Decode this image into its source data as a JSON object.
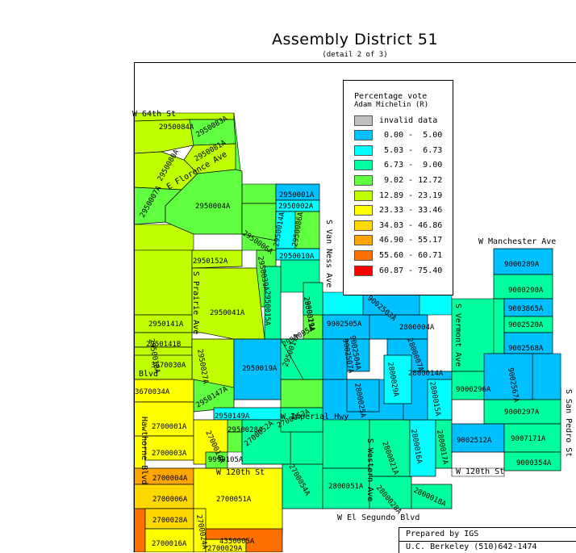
{
  "title": "Assembly District 51",
  "subtitle": "(detail 2 of 3)",
  "legend": {
    "title_line1": "Percentage vote",
    "title_line2": "Adam Michelin (R)",
    "classes": [
      {
        "label": "invalid data",
        "color": "#bfbfbf"
      },
      {
        "label": " 0.00 -  5.00",
        "color": "#00c0ff"
      },
      {
        "label": " 5.03 -  6.73",
        "color": "#00ffff"
      },
      {
        "label": " 6.73 -  9.00",
        "color": "#00ff9f"
      },
      {
        "label": " 9.02 - 12.72",
        "color": "#60ff40"
      },
      {
        "label": "12.89 - 23.19",
        "color": "#c0ff00"
      },
      {
        "label": "23.33 - 33.46",
        "color": "#ffff00"
      },
      {
        "label": "34.03 - 46.86",
        "color": "#ffd800"
      },
      {
        "label": "46.90 - 55.17",
        "color": "#ffa500"
      },
      {
        "label": "55.60 - 60.71",
        "color": "#ff7000"
      },
      {
        "label": "60.87 - 75.40",
        "color": "#ff0000"
      }
    ]
  },
  "streets": {
    "w64": "W 64th St",
    "florence": "E Florence Ave",
    "vanness": "S Van Ness Ave",
    "prairie": "S Prairie Ave",
    "manchester": "W Manchester Ave",
    "vermont": "S Vermont Ave",
    "sanpedro": "S San Pedro St",
    "imperial": "W Imperial Hwy",
    "w120a": "W 120th St",
    "w120b": "W 120th St",
    "western": "S Western Ave",
    "hawthorne": "Hawthorne Blvd",
    "elsegundo": "W El Segundo Blvd",
    "blvd": "Blvd"
  },
  "precincts": [
    {
      "id": "2950084A",
      "c": "#c0ff00"
    },
    {
      "id": "2950083A",
      "c": "#60ff40"
    },
    {
      "id": "2950081A",
      "c": "#c0ff00"
    },
    {
      "id": "2950080A",
      "c": "#c0ff00"
    },
    {
      "id": "2950007A",
      "c": "#60ff40"
    },
    {
      "id": "2950004A",
      "c": "#60ff40"
    },
    {
      "id": "2950001A",
      "c": "#00c0ff"
    },
    {
      "id": "2950002A",
      "c": "#00ffff"
    },
    {
      "id": "2950006A",
      "c": "#60ff40"
    },
    {
      "id": "2950086A",
      "c": "#60ff40"
    },
    {
      "id": "2950014A",
      "c": "#00ffff"
    },
    {
      "id": "2950010A",
      "c": "#00ffff"
    },
    {
      "id": "2950152A",
      "c": "#c0ff00"
    },
    {
      "id": "2950039A",
      "c": "#60ff40"
    },
    {
      "id": "2950041A",
      "c": "#c0ff00"
    },
    {
      "id": "2950015A",
      "c": "#00ff9f"
    },
    {
      "id": "2950141A",
      "c": "#c0ff00"
    },
    {
      "id": "2950141B",
      "c": "#c0ff00"
    },
    {
      "id": "2950018A",
      "c": "#c0ff00"
    },
    {
      "id": "2950027A",
      "c": "#c0ff00"
    },
    {
      "id": "2950019A",
      "c": "#00c0ff"
    },
    {
      "id": "2950017A",
      "c": "#00ff9f"
    },
    {
      "id": "2950029A",
      "c": "#60ff40"
    },
    {
      "id": "2950147A",
      "c": "#60ff40"
    },
    {
      "id": "2950149A",
      "c": "#00ffff"
    },
    {
      "id": "2950028A",
      "c": "#60ff40"
    },
    {
      "id": "3670030A",
      "c": "#c0ff00"
    },
    {
      "id": "3670034A",
      "c": "#ffff00"
    },
    {
      "id": "2700001A",
      "c": "#ffff00"
    },
    {
      "id": "2700003A",
      "c": "#ffff00"
    },
    {
      "id": "2700004A",
      "c": "#ffa500"
    },
    {
      "id": "2700006A",
      "c": "#ffd800"
    },
    {
      "id": "2700014A",
      "c": "#ffff00"
    },
    {
      "id": "9990105A",
      "c": "#60ff40"
    },
    {
      "id": "2700051A",
      "c": "#ffff00"
    },
    {
      "id": "2700028A",
      "c": "#ffd800"
    },
    {
      "id": "2700016A",
      "c": "#ffff00"
    },
    {
      "id": "2700024A",
      "c": "#ffff00"
    },
    {
      "id": "2700029A",
      "c": "#ffff00"
    },
    {
      "id": "4350005A",
      "c": "#ff7000"
    },
    {
      "id": "2700052A",
      "c": "#00ff9f"
    },
    {
      "id": "2700053A",
      "c": "#00ff9f"
    },
    {
      "id": "2700054A",
      "c": "#00ff9f"
    },
    {
      "id": "2800051A",
      "c": "#00ff9f"
    },
    {
      "id": "2800028A",
      "c": "#00ff9f"
    },
    {
      "id": "2800018A",
      "c": "#00ff9f"
    },
    {
      "id": "2800021A",
      "c": "#00ff9f"
    },
    {
      "id": "2800016A",
      "c": "#00ffff"
    },
    {
      "id": "2800017A",
      "c": "#00ff9f"
    },
    {
      "id": "9002505A",
      "c": "#00c0ff"
    },
    {
      "id": "2800004A",
      "c": "#00c0ff"
    },
    {
      "id": "9002504A",
      "c": "#00c0ff"
    },
    {
      "id": "9002503A",
      "c": "#00c0ff"
    },
    {
      "id": "9002507A",
      "c": "#00c0ff"
    },
    {
      "id": "2800007A",
      "c": "#00c0ff"
    },
    {
      "id": "2800014A",
      "c": "#00c0ff"
    },
    {
      "id": "2800015A",
      "c": "#00ffff"
    },
    {
      "id": "2800029A",
      "c": "#00ffff"
    },
    {
      "id": "2800025A",
      "c": "#00c0ff"
    },
    {
      "id": "2800011A",
      "c": "#00ff9f"
    },
    {
      "id": "2950095A",
      "c": "#00ff9f"
    },
    {
      "id": "9000289A",
      "c": "#00c0ff"
    },
    {
      "id": "9000290A",
      "c": "#00ff9f"
    },
    {
      "id": "9003865A",
      "c": "#00c0ff"
    },
    {
      "id": "9002520A",
      "c": "#00ff9f"
    },
    {
      "id": "9002568A",
      "c": "#00c0ff"
    },
    {
      "id": "9000296A",
      "c": "#00ff9f"
    },
    {
      "id": "9000297A",
      "c": "#00ff9f"
    },
    {
      "id": "9002512A",
      "c": "#00c0ff"
    },
    {
      "id": "9007171A",
      "c": "#00ff9f"
    },
    {
      "id": "9000354A",
      "c": "#00ff9f"
    },
    {
      "id": "9002567A",
      "c": "#00c0ff"
    }
  ],
  "footer": {
    "line1": "Prepared by IGS",
    "line2": "U.C. Berkeley (510)642-1474"
  }
}
